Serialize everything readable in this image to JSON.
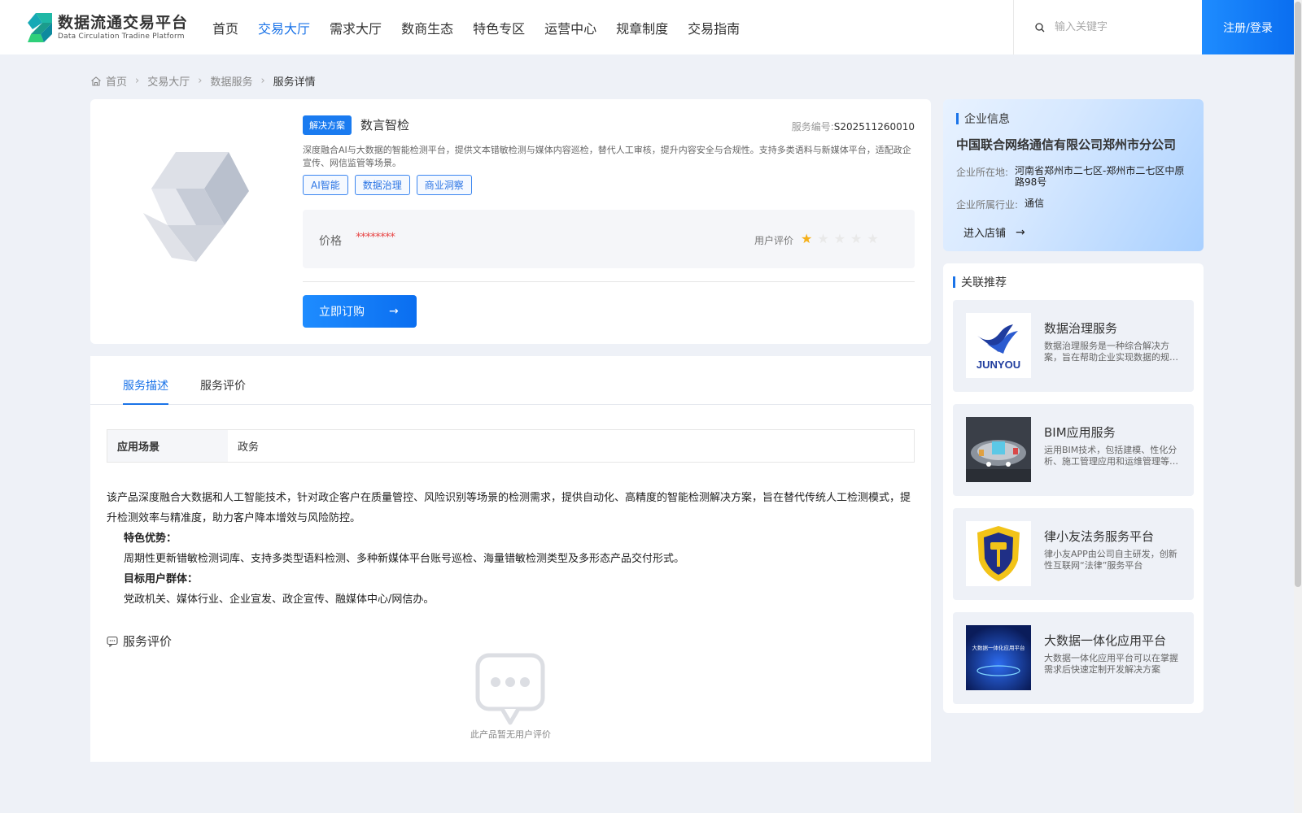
{
  "header": {
    "logo_cn": "数据流通交易平台",
    "logo_en": "Data Circulation Tradine Platform",
    "nav": [
      {
        "label": "首页",
        "active": false
      },
      {
        "label": "交易大厅",
        "active": true
      },
      {
        "label": "需求大厅",
        "active": false
      },
      {
        "label": "数商生态",
        "active": false
      },
      {
        "label": "特色专区",
        "active": false
      },
      {
        "label": "运营中心",
        "active": false
      },
      {
        "label": "规章制度",
        "active": false
      },
      {
        "label": "交易指南",
        "active": false
      }
    ],
    "search_placeholder": "输入关键字",
    "login_label": "注册/登录"
  },
  "breadcrumb": [
    "首页",
    "交易大厅",
    "数据服务",
    "服务详情"
  ],
  "product": {
    "badge": "解决方案",
    "name": "数言智检",
    "service_no_label": "服务编号:",
    "service_no": "S202511260010",
    "description": "深度融合AI与大数据的智能检测平台，提供文本错敏检测与媒体内容巡检，替代人工审核，提升内容安全与合规性。支持多类语料与新媒体平台，适配政企宣传、网信监管等场景。",
    "tags": [
      "AI智能",
      "数据治理",
      "商业洞察"
    ],
    "price_label": "价格",
    "price_value": "********",
    "rating_label": "用户评价",
    "rating": 1,
    "rating_max": 5,
    "buy_label": "立即订购"
  },
  "tabs": [
    {
      "label": "服务描述",
      "active": true
    },
    {
      "label": "服务评价",
      "active": false
    }
  ],
  "scene": {
    "key": "应用场景",
    "value": "政务"
  },
  "detail": {
    "intro": "该产品深度融合大数据和人工智能技术，针对政企客户在质量管控、风险识别等场景的检测需求，提供自动化、高精度的智能检测解决方案，旨在替代传统人工检测模式，提升检测效率与精准度，助力客户降本增效与风险防控。",
    "advantage_title": "特色优势：",
    "advantage_text": "周期性更新错敏检测词库、支持多类型语料检测、多种新媒体平台账号巡检、海量错敏检测类型及多形态产品交付形式。",
    "audience_title": "目标用户群体：",
    "audience_text": "党政机关、媒体行业、企业宣发、政企宣传、融媒体中心/网信办。"
  },
  "reviews": {
    "title": "服务评价",
    "empty_text": "此产品暂无用户评价"
  },
  "company": {
    "section_title": "企业信息",
    "name": "中国联合网络通信有限公司郑州市分公司",
    "location_label": "企业所在地:",
    "location": "河南省郑州市二七区-郑州市二七区中原路98号",
    "industry_label": "企业所属行业:",
    "industry": "通信",
    "enter_label": "进入店铺"
  },
  "recommend": {
    "section_title": "关联推荐",
    "items": [
      {
        "title": "数据治理服务",
        "desc": "数据治理服务是一种综合解决方案，旨在帮助企业实现数据的规范化管理与价值挖掘",
        "thumb_text": "JUNYOU"
      },
      {
        "title": "BIM应用服务",
        "desc": "运用BIM技术，包括建模、性化分析、施工管理应用和运维管理等服务",
        "thumb_text": ""
      },
      {
        "title": "律小友法务服务平台",
        "desc": "律小友APP由公司自主研发，创新性互联网“法律”服务平台",
        "thumb_text": ""
      },
      {
        "title": "大数据一体化应用平台",
        "desc": "大数据一体化应用平台可以在掌握需求后快速定制开发解决方案",
        "thumb_text": "大数据一体化应用平台"
      }
    ]
  },
  "colors": {
    "primary": "#1a73e8",
    "price": "#e84a4a",
    "star": "#f5b019"
  }
}
